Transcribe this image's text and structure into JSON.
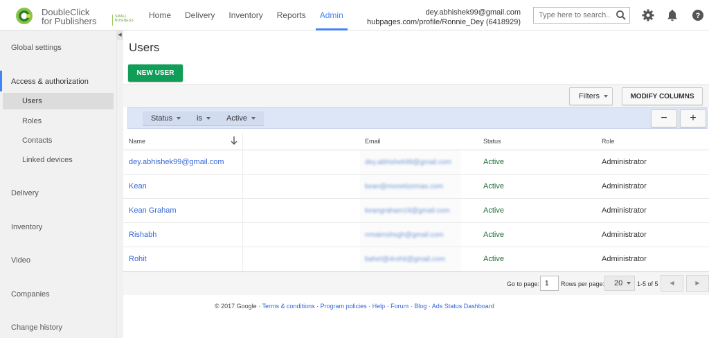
{
  "brand": {
    "line1": "DoubleClick",
    "line2": "for Publishers",
    "badge": "SMALL BUSINESS",
    "accent": "#8bc34a"
  },
  "nav": {
    "items": [
      {
        "label": "Home"
      },
      {
        "label": "Delivery"
      },
      {
        "label": "Inventory"
      },
      {
        "label": "Reports"
      },
      {
        "label": "Admin",
        "active": true
      }
    ]
  },
  "account": {
    "email": "dey.abhishek99@gmail.com",
    "network": "hubpages.com/profile/Ronnie_Dey (6418929)"
  },
  "search": {
    "placeholder": "Type here to search..."
  },
  "top_icons": [
    "search-icon",
    "gear-icon",
    "bell-icon",
    "help-icon"
  ],
  "sidebar": {
    "sections": [
      {
        "label": "Global settings"
      },
      {
        "label": "Access & authorization",
        "active": true,
        "items": [
          {
            "label": "Users",
            "selected": true
          },
          {
            "label": "Roles"
          },
          {
            "label": "Contacts"
          },
          {
            "label": "Linked devices"
          }
        ]
      },
      {
        "label": "Delivery"
      },
      {
        "label": "Inventory"
      },
      {
        "label": "Video"
      },
      {
        "label": "Companies"
      },
      {
        "label": "Change history"
      }
    ]
  },
  "main": {
    "title": "Users",
    "new_user_label": "NEW USER",
    "filters_label": "Filters",
    "modify_columns_label": "MODIFY COLUMNS",
    "filter": {
      "field": "Status",
      "operator": "is",
      "value": "Active"
    },
    "minus_label": "−",
    "plus_label": "+"
  },
  "table": {
    "columns": [
      "Name",
      "Email",
      "Status",
      "Role"
    ],
    "rows": [
      {
        "name": "dey.abhishek99@gmail.com",
        "email": "dey.abhishek99@gmail.com",
        "status": "Active",
        "role": "Administrator"
      },
      {
        "name": "Kean",
        "email": "kean@monetizemas.com",
        "status": "Active",
        "role": "Administrator"
      },
      {
        "name": "Kean Graham",
        "email": "keangraham19@gmail.com",
        "status": "Active",
        "role": "Administrator"
      },
      {
        "name": "Rishabh",
        "email": "rrmaimshsgh@gmail.com",
        "status": "Active",
        "role": "Administrator"
      },
      {
        "name": "Rohit",
        "email": "bahet@4rohit@gmail.com",
        "status": "Active",
        "role": "Administrator"
      }
    ]
  },
  "pager": {
    "goto_label": "Go to page:",
    "goto_value": "1",
    "rows_label": "Rows per page:",
    "rows_value": "20",
    "range": "1-5 of 5",
    "prev_label": "◀",
    "next_label": "▶"
  },
  "footer": {
    "copyright": "© 2017 Google",
    "links": [
      "Terms & conditions",
      "Program policies",
      "Help",
      "Forum",
      "Blog",
      "Ads Status Dashboard"
    ]
  },
  "colors": {
    "primary_blue": "#4285f4",
    "new_user_green": "#0f9d58",
    "link_blue": "#3367d6",
    "filter_row_bg": "#dde6f6"
  }
}
